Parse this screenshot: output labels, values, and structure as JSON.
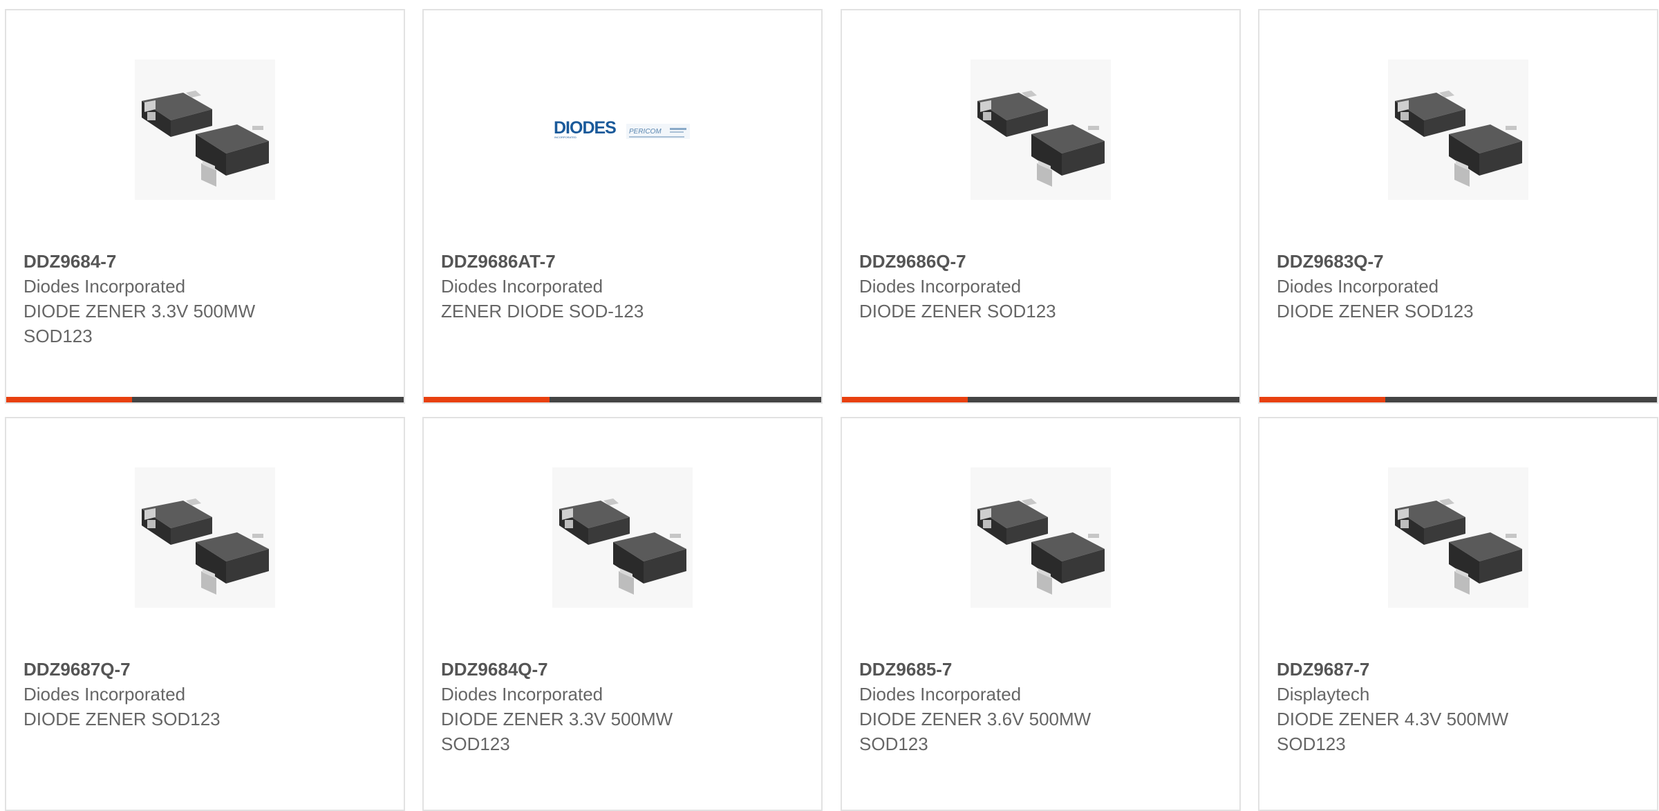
{
  "colors": {
    "accent": "#e8400f",
    "bar": "#444444",
    "card_border": "#e2e2e2",
    "part_number": "#555555",
    "body_text": "#666666"
  },
  "products": [
    {
      "part_number": "DDZ9684-7",
      "manufacturer": "Diodes Incorporated",
      "description": "DIODE ZENER 3.3V 500MW SOD123",
      "image": "sod123-package-image"
    },
    {
      "part_number": "DDZ9686AT-7",
      "manufacturer": "Diodes Incorporated",
      "description": "ZENER DIODE SOD-123",
      "image": "diodes-pericom-logo",
      "logo_text": "DIODES",
      "logo_subtext": "INCORPORATED",
      "logo_text_2": "PERICOM"
    },
    {
      "part_number": "DDZ9686Q-7",
      "manufacturer": "Diodes Incorporated",
      "description": "DIODE ZENER SOD123",
      "image": "sod123-package-image"
    },
    {
      "part_number": "DDZ9683Q-7",
      "manufacturer": "Diodes Incorporated",
      "description": "DIODE ZENER SOD123",
      "image": "sod123-package-image"
    },
    {
      "part_number": "DDZ9687Q-7",
      "manufacturer": "Diodes Incorporated",
      "description": "DIODE ZENER SOD123",
      "image": "sod123-package-image"
    },
    {
      "part_number": "DDZ9684Q-7",
      "manufacturer": "Diodes Incorporated",
      "description": "DIODE ZENER 3.3V 500MW SOD123",
      "image": "sod123-package-image"
    },
    {
      "part_number": "DDZ9685-7",
      "manufacturer": "Diodes Incorporated",
      "description": "DIODE ZENER 3.6V 500MW SOD123",
      "image": "sod123-package-image"
    },
    {
      "part_number": "DDZ9687-7",
      "manufacturer": "Displaytech",
      "description": "DIODE ZENER 4.3V 500MW SOD123",
      "image": "sod123-package-image"
    }
  ]
}
